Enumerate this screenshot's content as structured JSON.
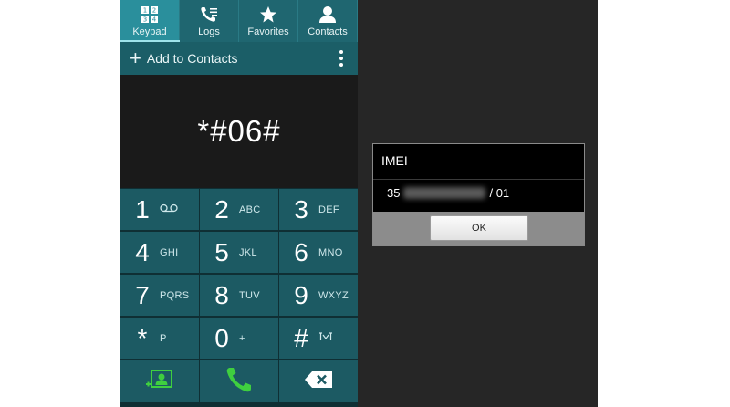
{
  "tabs": [
    {
      "label": "Keypad",
      "icon": "keypad-grid-icon",
      "active": true
    },
    {
      "label": "Logs",
      "icon": "call-log-icon",
      "active": false
    },
    {
      "label": "Favorites",
      "icon": "star-icon",
      "active": false
    },
    {
      "label": "Contacts",
      "icon": "person-icon",
      "active": false
    }
  ],
  "actionbar": {
    "add_label": "Add to Contacts",
    "add_icon": "plus-icon",
    "menu_icon": "overflow-menu-icon"
  },
  "display": {
    "number": "*#06#"
  },
  "keypad": {
    "keys": [
      {
        "digit": "1",
        "letters": "",
        "icon": "voicemail-icon"
      },
      {
        "digit": "2",
        "letters": "ABC"
      },
      {
        "digit": "3",
        "letters": "DEF"
      },
      {
        "digit": "4",
        "letters": "GHI"
      },
      {
        "digit": "5",
        "letters": "JKL"
      },
      {
        "digit": "6",
        "letters": "MNO"
      },
      {
        "digit": "7",
        "letters": "PQRS"
      },
      {
        "digit": "8",
        "letters": "TUV"
      },
      {
        "digit": "9",
        "letters": "WXYZ"
      },
      {
        "digit": "*",
        "letters": "P"
      },
      {
        "digit": "0",
        "letters": "+"
      },
      {
        "digit": "#",
        "letters": "",
        "icon": "wait-pause-icon"
      }
    ],
    "bottom": {
      "contact_icon": "contact-card-icon",
      "call_icon": "phone-call-icon",
      "delete_icon": "backspace-icon"
    }
  },
  "dialog": {
    "title": "IMEI",
    "value_prefix": "35",
    "value_suffix": "/ 01",
    "ok_label": "OK"
  },
  "colors": {
    "teal_key": "#1c5a63",
    "tab_active": "#2a8f9c",
    "call_green": "#3fcf3f"
  }
}
